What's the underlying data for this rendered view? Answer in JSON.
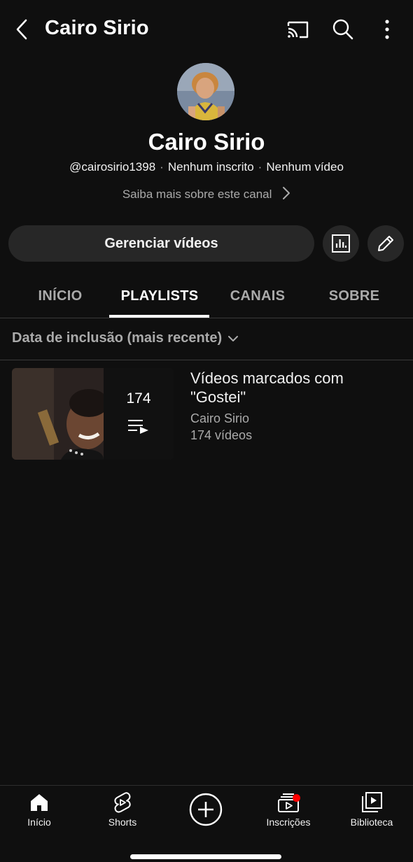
{
  "header": {
    "title": "Cairo Sirio",
    "icons": [
      "back-icon",
      "cast-icon",
      "search-icon",
      "more-vertical-icon"
    ]
  },
  "channel": {
    "name": "Cairo Sirio",
    "handle": "@cairosirio1398",
    "subscribers": "Nenhum inscrito",
    "videos": "Nenhum vídeo",
    "about_link": "Saiba mais sobre este canal"
  },
  "actions": {
    "manage_label": "Gerenciar vídeos",
    "icons": [
      "analytics-icon",
      "edit-pencil-icon"
    ]
  },
  "tabs": [
    {
      "label": "INÍCIO",
      "active": false
    },
    {
      "label": "PLAYLISTS",
      "active": true
    },
    {
      "label": "CANAIS",
      "active": false
    },
    {
      "label": "SOBRE",
      "active": false
    }
  ],
  "sort": {
    "label": "Data de inclusão (mais recente)"
  },
  "playlists": [
    {
      "count": "174",
      "title": "Vídeos marcados com \"Gostei\"",
      "owner": "Cairo Sirio",
      "videos_label": "174 vídeos"
    }
  ],
  "bottom_nav": [
    {
      "label": "Início",
      "icon": "home-icon"
    },
    {
      "label": "Shorts",
      "icon": "shorts-icon"
    },
    {
      "label": "",
      "icon": "create-plus-icon"
    },
    {
      "label": "Inscrições",
      "icon": "subscriptions-icon"
    },
    {
      "label": "Biblioteca",
      "icon": "library-icon"
    }
  ],
  "colors": {
    "background": "#0f0f0f",
    "button_bg": "#272727",
    "secondary_text": "#aaaaaa",
    "notification_dot": "#ff0000"
  }
}
